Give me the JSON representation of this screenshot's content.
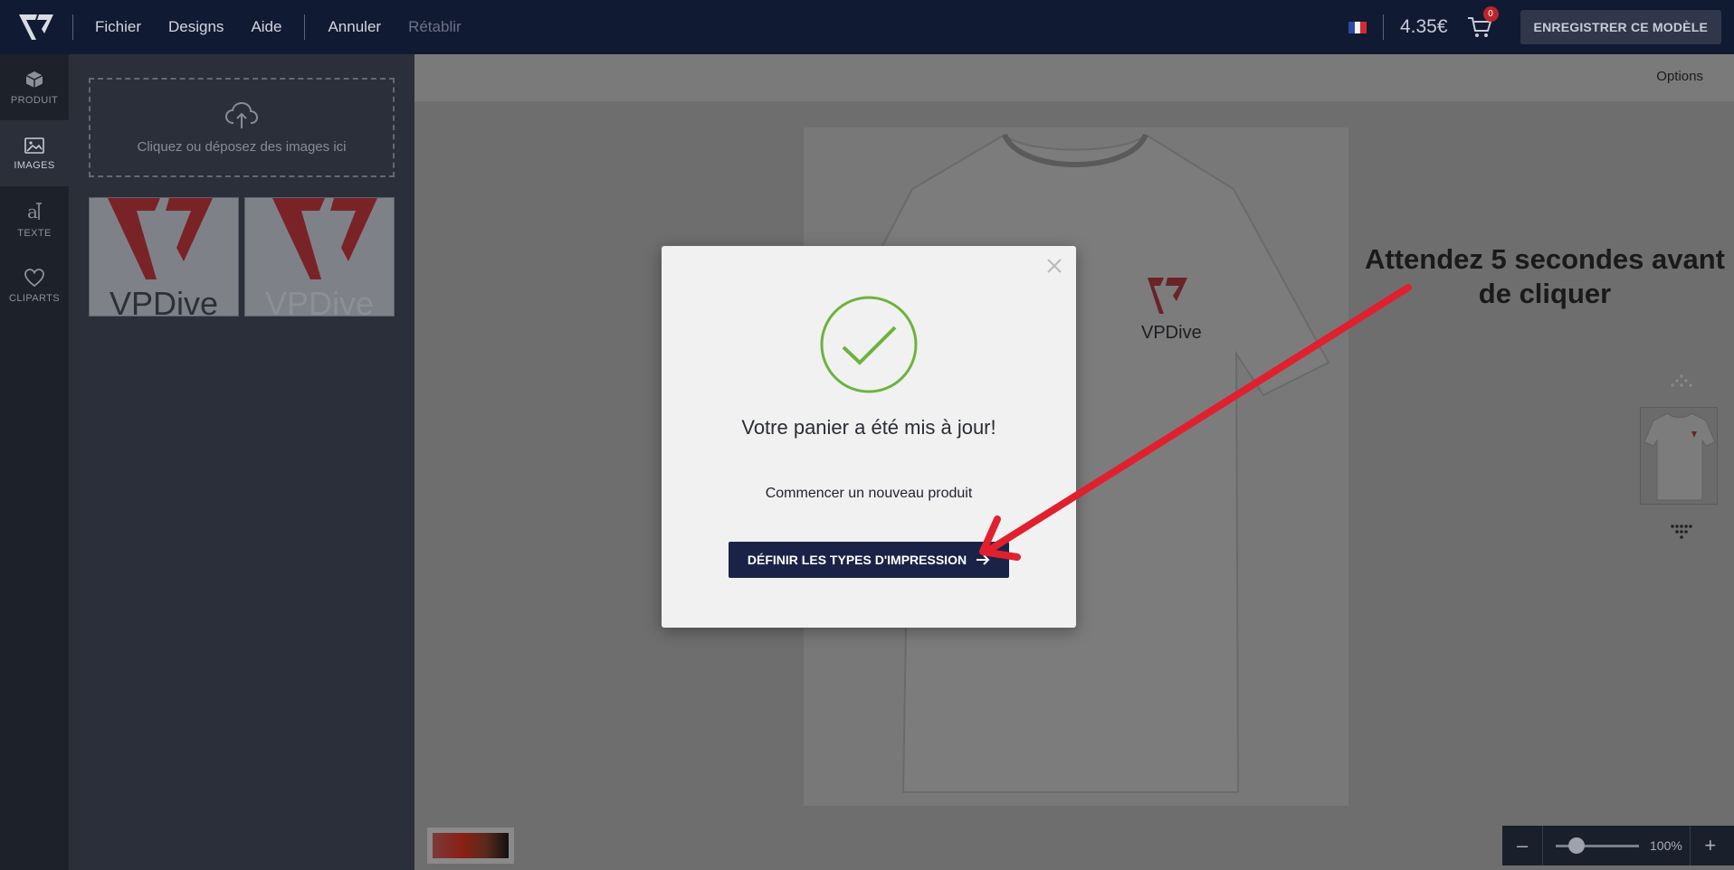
{
  "topbar": {
    "menu": [
      "Fichier",
      "Designs",
      "Aide"
    ],
    "undo": "Annuler",
    "redo": "Rétablir",
    "price": "4.35€",
    "cart_count": "0",
    "save_label": "ENREGISTRER CE MODÈLE"
  },
  "rail": {
    "items": [
      {
        "label": "PRODUIT",
        "icon": "box-icon"
      },
      {
        "label": "IMAGES",
        "icon": "image-icon"
      },
      {
        "label": "TEXTE",
        "icon": "text-icon"
      },
      {
        "label": "CLIPARTS",
        "icon": "heart-icon"
      }
    ],
    "active": "IMAGES"
  },
  "panel": {
    "dropzone_text": "Cliquez ou déposez des images ici",
    "thumbnails": [
      {
        "text": "VPDive"
      },
      {
        "text": "VPDive"
      }
    ]
  },
  "canvas": {
    "options_label": "Options",
    "product_logo_text": "VPDive",
    "annotation_line1": "Attendez 5 secondes avant",
    "annotation_line2": "de cliquer",
    "zoom_value": "100%",
    "zoom_level": 0.25
  },
  "modal": {
    "title": "Votre panier a été mis à jour!",
    "link": "Commencer un nouveau produit",
    "cta": "DÉFINIR LES TYPES D'IMPRESSION"
  },
  "colors": {
    "topbar_bg": "#111a33",
    "accent_red": "#b7262c",
    "success_green": "#6db33f",
    "cta_bg": "#1a2347",
    "annotation_arrow": "#e0202e"
  }
}
